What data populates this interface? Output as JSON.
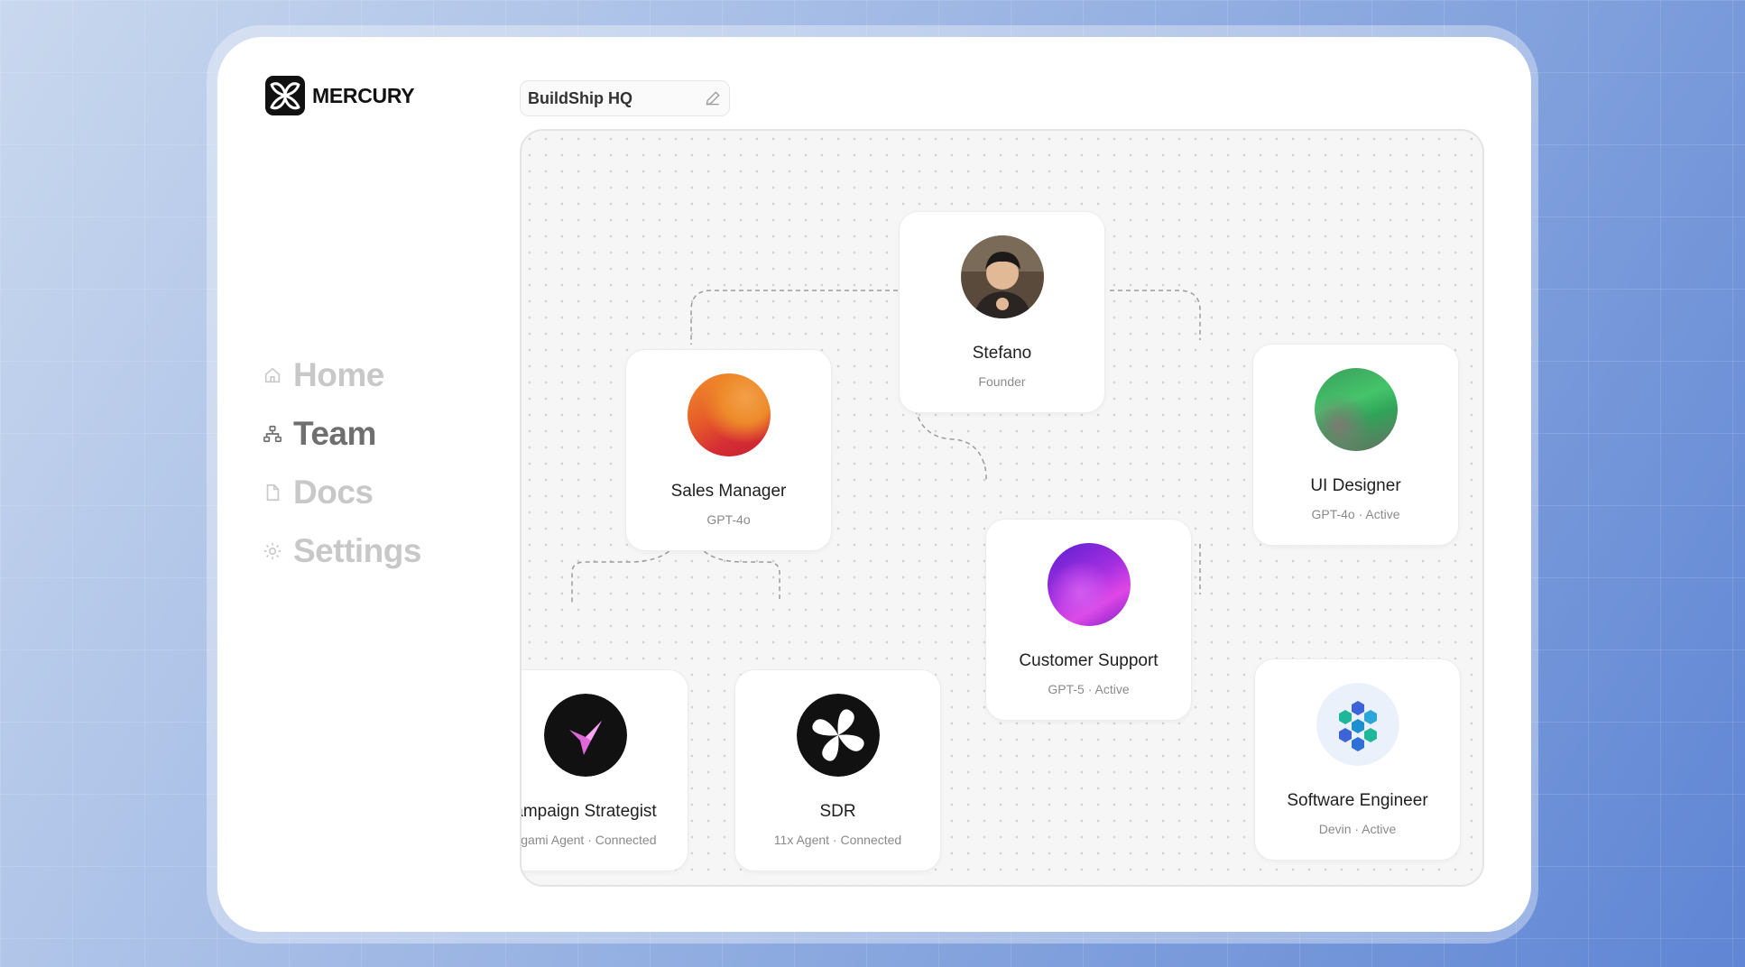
{
  "app": {
    "brand": "MERCURY"
  },
  "sidebar": {
    "items": [
      {
        "label": "Home",
        "icon": "home-icon"
      },
      {
        "label": "Team",
        "icon": "org-chart-icon",
        "active": true
      },
      {
        "label": "Docs",
        "icon": "document-icon"
      },
      {
        "label": "Settings",
        "icon": "gear-icon"
      }
    ]
  },
  "workspace": {
    "name": "BuildShip HQ",
    "edit_icon": "pencil-icon"
  },
  "team": {
    "nodes": [
      {
        "id": "stefano",
        "name": "Stefano",
        "subtitle": "Founder",
        "avatar": "photo-avatar"
      },
      {
        "id": "sales",
        "name": "Sales Manager",
        "subtitle": "GPT-4o",
        "avatar": "orange-red-orb"
      },
      {
        "id": "designer",
        "name": "UI Designer",
        "subtitle": "GPT-4o · Active",
        "avatar": "green-orb"
      },
      {
        "id": "support",
        "name": "Customer Support",
        "subtitle": "GPT-5 · Active",
        "avatar": "purple-orb"
      },
      {
        "id": "campaign",
        "name": "ampaign Strategist",
        "subtitle": "rigami Agent · Connected",
        "avatar": "origami-bird-logo"
      },
      {
        "id": "sdr",
        "name": "SDR",
        "subtitle": "11x Agent · Connected",
        "avatar": "11x-logo"
      },
      {
        "id": "engineer",
        "name": "Software Engineer",
        "subtitle": "Devin · Active",
        "avatar": "hexagon-cluster-logo"
      }
    ]
  },
  "colors": {
    "background_start": "#c9d8ee",
    "background_end": "#5f85d4",
    "active_nav": "#6f6f6f",
    "inactive_nav": "#c8c8c8"
  }
}
